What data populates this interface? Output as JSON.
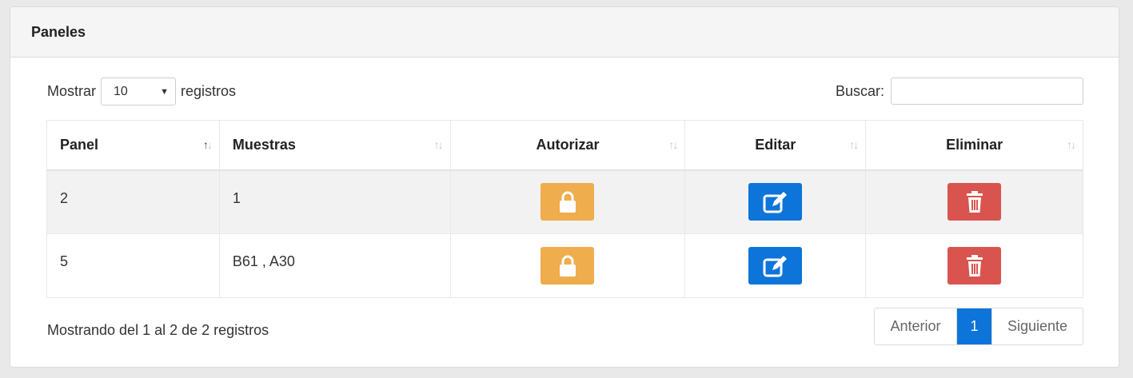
{
  "panel": {
    "title": "Paneles"
  },
  "length": {
    "prefix": "Mostrar",
    "value": "10",
    "suffix": "registros"
  },
  "search": {
    "label": "Buscar:",
    "value": ""
  },
  "table": {
    "columns": [
      "Panel",
      "Muestras",
      "Autorizar",
      "Editar",
      "Eliminar"
    ],
    "rows": [
      {
        "panel": "2",
        "muestras": "1"
      },
      {
        "panel": "5",
        "muestras": "B61 , A30"
      }
    ]
  },
  "footer": {
    "info": "Mostrando del 1 al 2 de 2 registros",
    "prev": "Anterior",
    "page": "1",
    "next": "Siguiente"
  },
  "icons": {
    "authorize": "lock-icon",
    "edit": "edit-icon",
    "delete": "trash-icon"
  },
  "colors": {
    "warning": "#efad4d",
    "primary": "#0d74d9",
    "danger": "#d9534f"
  }
}
